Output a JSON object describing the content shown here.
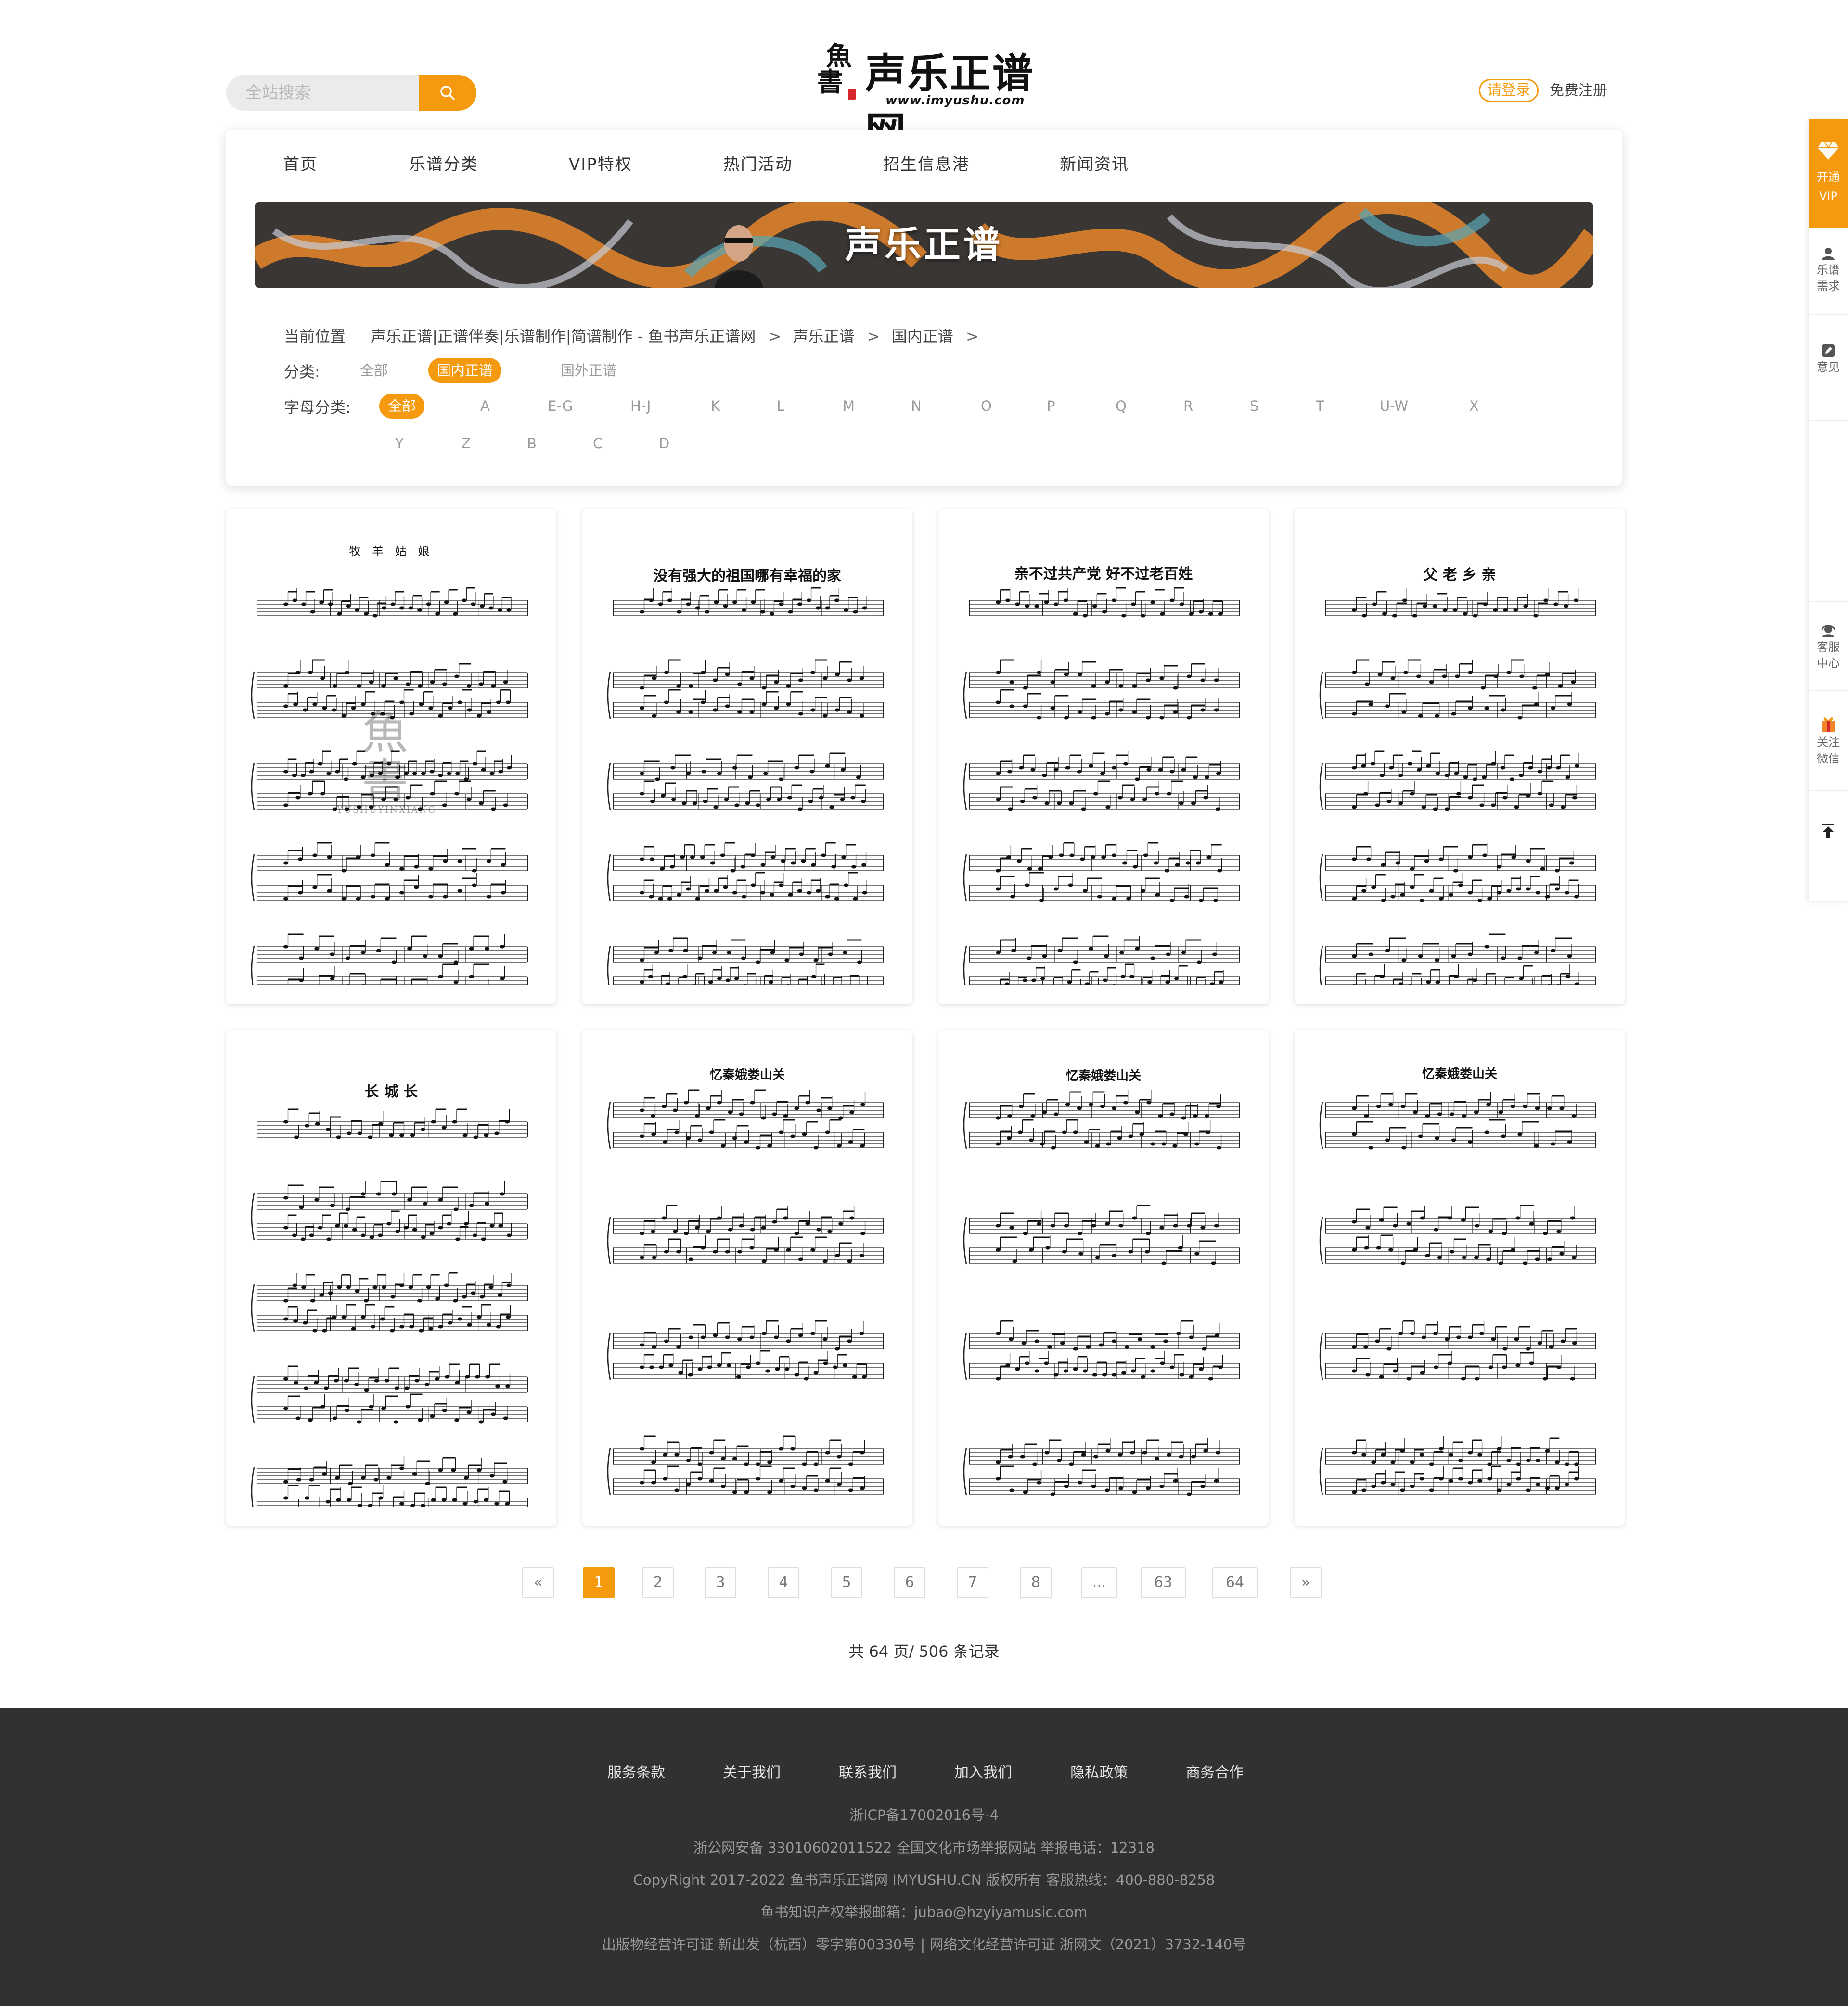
{
  "search": {
    "placeholder": "全站搜索"
  },
  "logo": {
    "mark_top": "魚",
    "mark_bottom": "書",
    "name": "声乐正谱网",
    "url": "www.imyushu.com"
  },
  "account": {
    "login": "请登录",
    "register": "免费注册"
  },
  "nav": [
    "首页",
    "乐谱分类",
    "VIP特权",
    "热门活动",
    "招生信息港",
    "新闻资讯"
  ],
  "banner": {
    "title": "声乐正谱"
  },
  "breadcrumb": {
    "label": "当前位置",
    "items": [
      "声乐正谱|正谱伴奏|乐谱制作|简谱制作 - 鱼书声乐正谱网",
      "声乐正谱",
      "国内正谱"
    ],
    "separator": ">"
  },
  "category": {
    "label": "分类:",
    "options": [
      "全部",
      "国内正谱",
      "国外正谱"
    ],
    "selected": "国内正谱"
  },
  "letters": {
    "label": "字母分类:",
    "selected": "全部",
    "row1": [
      "全部",
      "A",
      "E-G",
      "H-J",
      "K",
      "L",
      "M",
      "N",
      "O",
      "P",
      "Q",
      "R",
      "S",
      "T",
      "U-W",
      "X"
    ],
    "row2": [
      "Y",
      "Z",
      "B",
      "C",
      "D"
    ]
  },
  "scores": [
    {
      "title": "牧 羊 姑 娘",
      "watermark": "YUSHUYINXIANG"
    },
    {
      "title": "没有强大的祖国哪有幸福的家"
    },
    {
      "title": "亲不过共产党 好不过老百姓"
    },
    {
      "title": "父 老 乡 亲"
    },
    {
      "title": "长 城 长"
    },
    {
      "title": "忆秦娥娄山关"
    },
    {
      "title": "忆秦娥娄山关"
    },
    {
      "title": "忆秦娥娄山关"
    }
  ],
  "pagination": {
    "prev": "«",
    "next": "»",
    "pages": [
      "1",
      "2",
      "3",
      "4",
      "5",
      "6",
      "7",
      "8",
      "...",
      "63",
      "64"
    ],
    "current": "1",
    "total_text": "共 64 页/ 506 条记录"
  },
  "footer": {
    "links": [
      "服务条款",
      "关于我们",
      "联系我们",
      "加入我们",
      "隐私政策",
      "商务合作"
    ],
    "lines": [
      "浙ICP备17002016号-4",
      "浙公网安备 33010602011522 全国文化市场举报网站 举报电话：12318",
      "CopyRight  2017-2022 鱼书声乐正谱网 IMYUSHU.CN 版权所有 客服热线：400-880-8258",
      "鱼书知识产权举报邮箱：jubao@hzyiyamusic.com",
      "出版物经营许可证 新出发（杭西）零字第00330号 | 网络文化经营许可证 浙网文（2021）3732-140号"
    ]
  },
  "sidebar": {
    "vip": [
      "开通",
      "VIP"
    ],
    "demand": [
      "乐谱",
      "需求"
    ],
    "feedback": [
      "意见"
    ],
    "service": [
      "客服",
      "中心"
    ],
    "wechat": [
      "关注",
      "微信"
    ]
  },
  "icons": [
    "search-icon",
    "diamond-icon",
    "user-icon",
    "edit-icon",
    "headset-icon",
    "gift-icon",
    "arrow-up-icon"
  ],
  "colors": {
    "accent": "#f59a0f",
    "footer_bg": "#313131"
  }
}
